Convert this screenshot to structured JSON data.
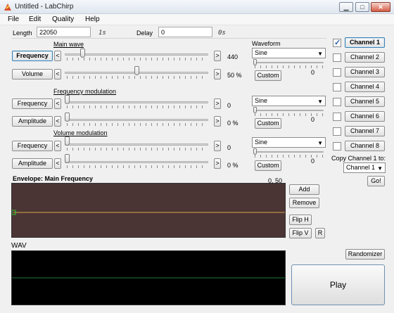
{
  "window": {
    "title": "Untitled - LabChirp",
    "controls": {
      "minimize": "▁",
      "maximize": "□",
      "close": "✕"
    }
  },
  "menu": [
    "File",
    "Edit",
    "Quality",
    "Help"
  ],
  "length": {
    "label": "Length",
    "value": "22050",
    "unit": "1s"
  },
  "delay": {
    "label": "Delay",
    "value": "0",
    "unit": "0s"
  },
  "waveform_label": "Waveform",
  "main_wave": {
    "title": "Main wave",
    "frequency": {
      "button": "Frequency",
      "value": "440",
      "level": 0.11
    },
    "volume": {
      "button": "Volume",
      "value": "50 %",
      "level": 0.5
    },
    "waveform": "Sine",
    "custom": "Custom",
    "shape_value": "0"
  },
  "freq_mod": {
    "title": "Frequency modulation",
    "frequency": {
      "button": "Frequency",
      "value": "0",
      "level": 0.0
    },
    "amplitude": {
      "button": "Amplitude",
      "value": "0 %",
      "level": 0.0
    },
    "waveform": "Sine",
    "custom": "Custom",
    "shape_value": "0"
  },
  "vol_mod": {
    "title": "Volume modulation",
    "frequency": {
      "button": "Frequency",
      "value": "0",
      "level": 0.0
    },
    "amplitude": {
      "button": "Amplitude",
      "value": "0 %",
      "level": 0.0
    },
    "waveform": "Sine",
    "custom": "Custom",
    "shape_value": "0"
  },
  "arrows": {
    "left": "<",
    "right": ">"
  },
  "channels": [
    {
      "label": "Channel 1",
      "checked": true,
      "active": true
    },
    {
      "label": "Channel 2",
      "checked": false,
      "active": false
    },
    {
      "label": "Channel 3",
      "checked": false,
      "active": false
    },
    {
      "label": "Channel 4",
      "checked": false,
      "active": false
    },
    {
      "label": "Channel 5",
      "checked": false,
      "active": false
    },
    {
      "label": "Channel 6",
      "checked": false,
      "active": false
    },
    {
      "label": "Channel 7",
      "checked": false,
      "active": false
    },
    {
      "label": "Channel 8",
      "checked": false,
      "active": false
    }
  ],
  "copy": {
    "label": "Copy Channel 1 to:",
    "target": "Channel 1",
    "go": "Go!"
  },
  "envelope": {
    "title": "Envelope: Main Frequency",
    "coords": "0, 50",
    "add": "Add",
    "remove": "Remove",
    "flip_h": "Flip H",
    "flip_v": "Flip V",
    "reset": "R",
    "background": "#4b3434",
    "line_color": "#d4a54a",
    "point_color": "#33cc33"
  },
  "wav": {
    "label": "WAV",
    "background": "#000000",
    "line_color": "#1f7a3a"
  },
  "randomizer": "Randomizer",
  "play": "Play"
}
